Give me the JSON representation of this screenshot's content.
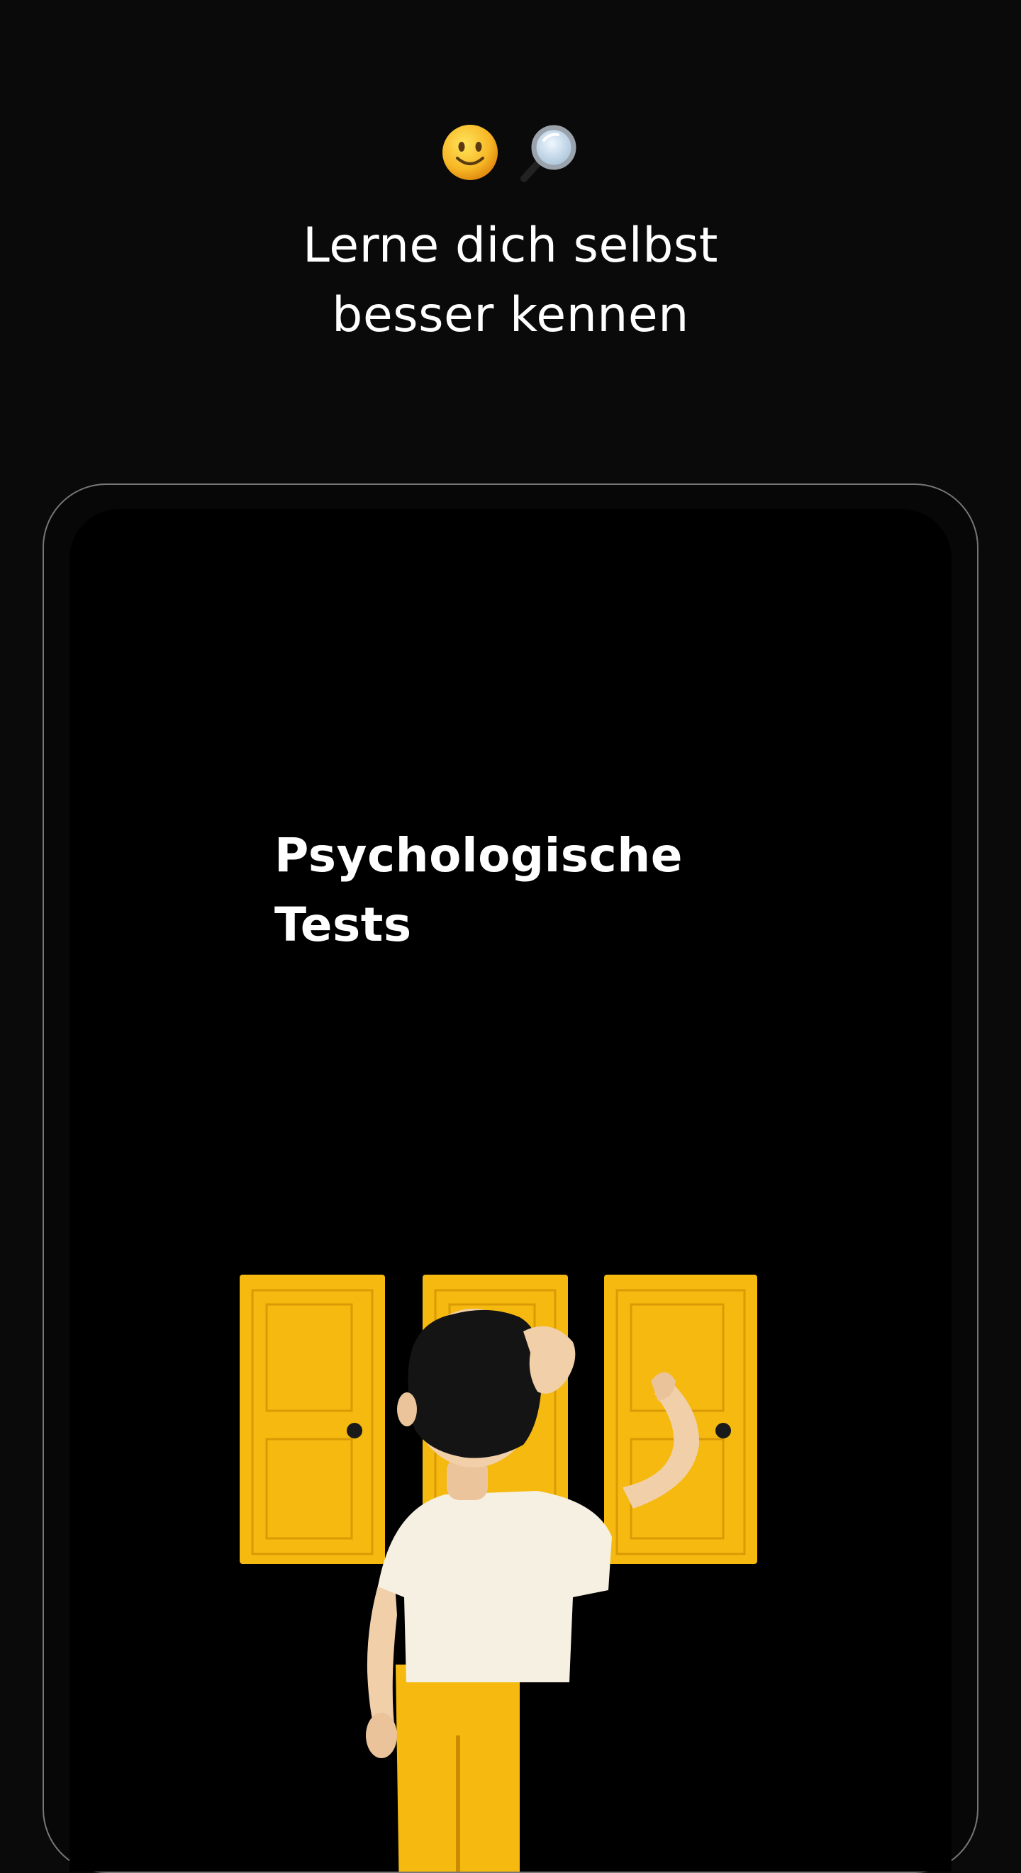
{
  "header": {
    "emojis": [
      "smiling-face-icon",
      "magnifying-glass-icon"
    ],
    "headline_line1": "Lerne dich selbst",
    "headline_line2": "besser kennen"
  },
  "card": {
    "title_line1": "Psychologische",
    "title_line2": "Tests",
    "illustration": "person-facing-three-yellow-doors"
  },
  "colors": {
    "background": "#000000",
    "door_yellow": "#F5B90F",
    "text": "#FFFFFF"
  }
}
